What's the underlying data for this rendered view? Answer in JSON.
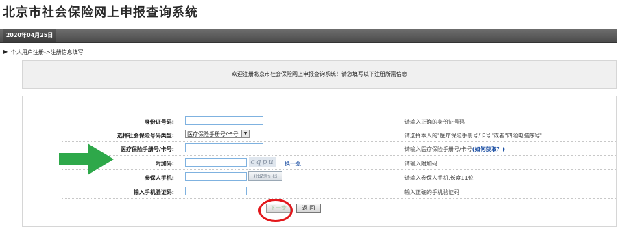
{
  "header": {
    "title": "北京市社会保险网上申报查询系统",
    "date": "2020年04月25日"
  },
  "breadcrumb": "个人用户注册->注册信息填写",
  "welcome": "欢迎注册北京市社会保险网上申报查询系统！请您填写以下注册所需信息",
  "form": {
    "id_label": "身份证号码:",
    "id_hint": "请输入正确的身份证号码",
    "type_label": "选择社会保险号码类型:",
    "type_selected": "医疗保险手册号/卡号",
    "type_hint": "请选择本人的\"医疗保险手册号/卡号\"或者\"四险电脑序号\"",
    "card_label": "医疗保险手册号/卡号:",
    "card_hint": "请输入医疗保险手册号/卡号",
    "card_hint_link": "(如何获取？)",
    "captcha_label": "附加码:",
    "captcha_text": "cqpu",
    "captcha_refresh": "换一张",
    "captcha_hint": "请输入附加码",
    "phone_label": "参保人手机:",
    "phone_button": "获取验证码",
    "phone_hint": "请输入参保人手机,长度11位",
    "sms_label": "输入手机验证码:",
    "sms_hint": "输入正确的手机验证码"
  },
  "buttons": {
    "next": "下一步",
    "back": "返 回"
  },
  "colors": {
    "arrow": "#2ea84a",
    "ring": "#e3171b",
    "link": "#1c4fa3"
  }
}
